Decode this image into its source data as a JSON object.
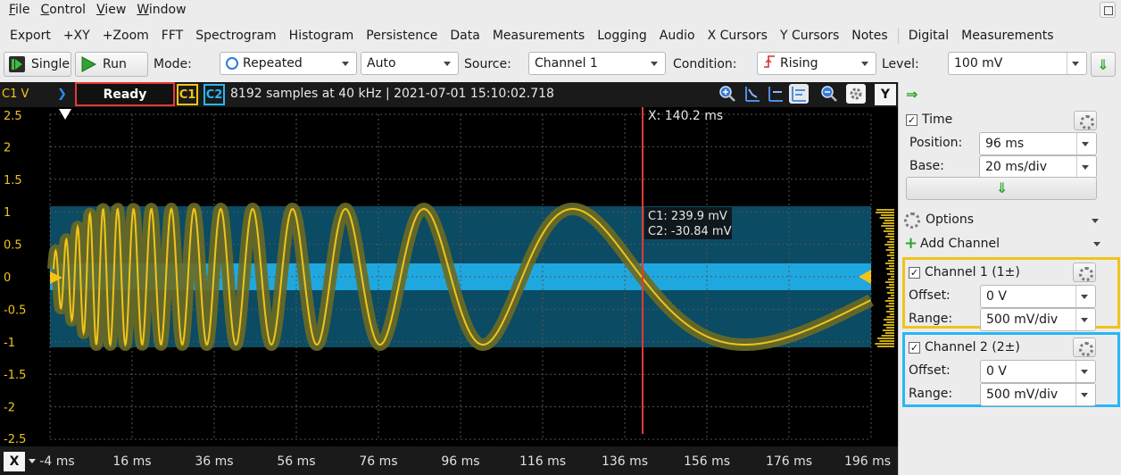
{
  "menu": [
    {
      "key": "F",
      "rest": "ile"
    },
    {
      "key": "C",
      "rest": "ontrol"
    },
    {
      "key": "V",
      "rest": "iew"
    },
    {
      "key": "W",
      "rest": "indow"
    }
  ],
  "toolbar": {
    "items": [
      "Export",
      "+XY",
      "+Zoom",
      "FFT",
      "Spectrogram",
      "Histogram",
      "Persistence",
      "Data",
      "Measurements",
      "Logging",
      "Audio",
      "X Cursors",
      "Y Cursors",
      "Notes"
    ],
    "items2": [
      "Digital",
      "Measurements"
    ]
  },
  "controls": {
    "single_label": "Single",
    "run_label": "Run",
    "mode_label": "Mode:",
    "mode_value": "Repeated",
    "auto_value": "Auto",
    "source_label": "Source:",
    "source_value": "Channel 1",
    "condition_label": "Condition:",
    "condition_value": "Rising",
    "level_label": "Level:",
    "level_value": "100 mV"
  },
  "plotbar": {
    "ch_label": "C1 V",
    "status": "Ready",
    "c1": "C1",
    "c2": "C2",
    "info": "8192 samples at 40 kHz | 2021-07-01 15:10:02.718",
    "y_button": "Y"
  },
  "plot": {
    "y_ticks": [
      "2.5",
      "2",
      "1.5",
      "1",
      "0.5",
      "0",
      "-0.5",
      "-1",
      "-1.5",
      "-2",
      "-2.5"
    ],
    "cursor_x_label": "X: 140.2 ms",
    "cursor_c1": "C1: 239.9 mV",
    "cursor_c2": "C2: -30.84 mV",
    "c1_color": "#f0c419",
    "c2_color": "#29b6f6",
    "cursor_color": "#e53935"
  },
  "xaxis": {
    "button": "X",
    "ticks": [
      "-4 ms",
      "16 ms",
      "36 ms",
      "56 ms",
      "76 ms",
      "96 ms",
      "116 ms",
      "136 ms",
      "156 ms",
      "176 ms",
      "196 ms"
    ]
  },
  "panel": {
    "time_label": "Time",
    "position_label": "Position:",
    "position_value": "96 ms",
    "base_label": "Base:",
    "base_value": "20 ms/div",
    "options_label": "Options",
    "add_channel_label": "Add Channel",
    "ch1_title": "Channel 1 (1±)",
    "ch1_offset_label": "Offset:",
    "ch1_offset_value": "0 V",
    "ch1_range_label": "Range:",
    "ch1_range_value": "500 mV/div",
    "ch2_title": "Channel 2 (2±)",
    "ch2_offset_label": "Offset:",
    "ch2_offset_value": "0 V",
    "ch2_range_label": "Range:",
    "ch2_range_value": "500 mV/div"
  }
}
